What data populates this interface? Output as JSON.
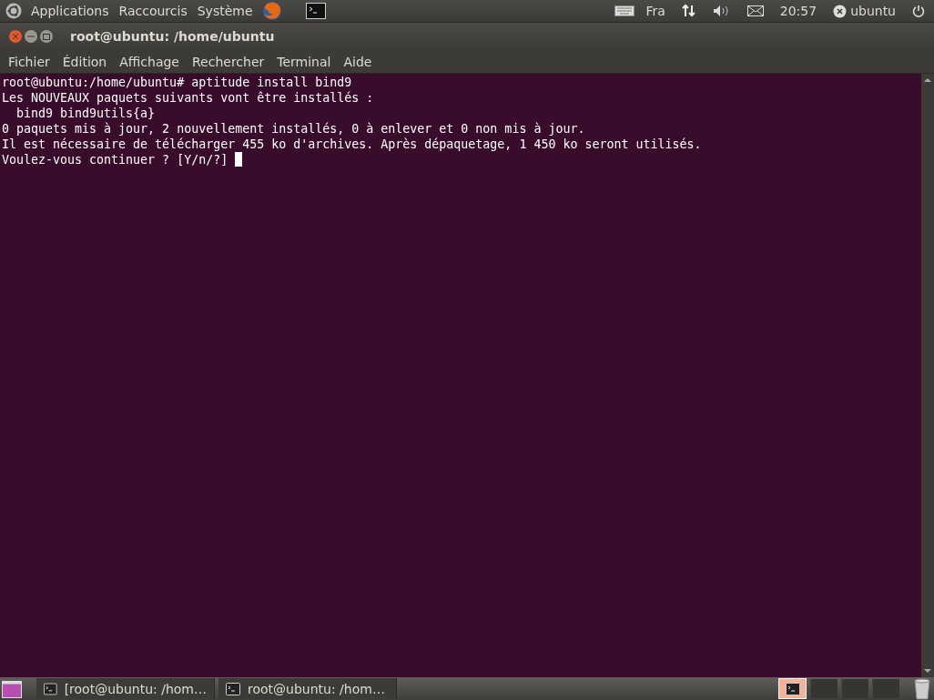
{
  "top_panel": {
    "menus": [
      "Applications",
      "Raccourcis",
      "Système"
    ],
    "keyboard_layout": "Fra",
    "clock": "20:57",
    "user": "ubuntu"
  },
  "window": {
    "title": "root@ubuntu: /home/ubuntu"
  },
  "menubar": [
    "Fichier",
    "Édition",
    "Affichage",
    "Rechercher",
    "Terminal",
    "Aide"
  ],
  "terminal": {
    "lines": [
      "root@ubuntu:/home/ubuntu# aptitude install bind9",
      "Les NOUVEAUX paquets suivants vont être installés :",
      "  bind9 bind9utils{a}",
      "0 paquets mis à jour, 2 nouvellement installés, 0 à enlever et 0 non mis à jour.",
      "Il est nécessaire de télécharger 455 ko d'archives. Après dépaquetage, 1 450 ko seront utilisés.",
      "Voulez-vous continuer ? [Y/n/?] "
    ]
  },
  "taskbar": {
    "windows": [
      {
        "label": "[root@ubuntu: /hom…"
      },
      {
        "label": "root@ubuntu: /hom…"
      }
    ],
    "workspaces": [
      {
        "selected": true
      },
      {
        "selected": false
      },
      {
        "selected": false
      },
      {
        "selected": false
      }
    ]
  }
}
